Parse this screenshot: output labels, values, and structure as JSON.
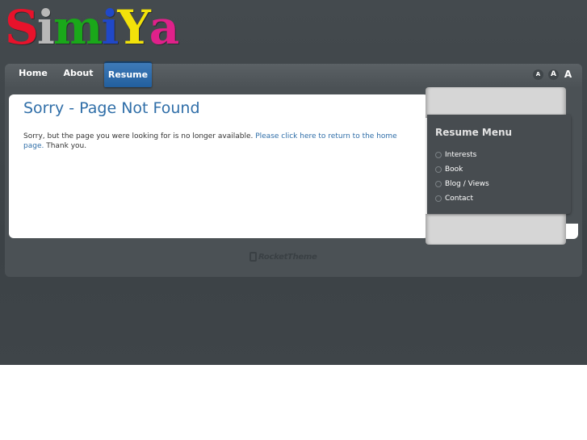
{
  "logo": {
    "letters": [
      "S",
      "i",
      "m",
      "i",
      "Y",
      "a"
    ],
    "colors": [
      "#e8122b",
      "#b8b8b8",
      "#1aa81a",
      "#2048c8",
      "#f2e20a",
      "#e0218a"
    ]
  },
  "nav": {
    "items": [
      {
        "label": "Home",
        "active": false
      },
      {
        "label": "About",
        "active": false
      },
      {
        "label": "Resume",
        "active": true
      }
    ],
    "font_controls": [
      "A",
      "A",
      "A"
    ]
  },
  "main": {
    "title": "Sorry - Page Not Found",
    "message_before": "Sorry, but the page you were looking for is no longer available. ",
    "link_text": "Please click here to return to the home page.",
    "message_after": " Thank you."
  },
  "sidebar": {
    "title": "Resume Menu",
    "items": [
      {
        "label": "Interests"
      },
      {
        "label": "Book"
      },
      {
        "label": "Blog / Views"
      },
      {
        "label": "Contact"
      }
    ]
  },
  "footer": {
    "brand": "RocketTheme"
  },
  "colors": {
    "accent": "#2f6ea8",
    "nav_active": "#225f9e",
    "page_background": "#3f4549"
  }
}
